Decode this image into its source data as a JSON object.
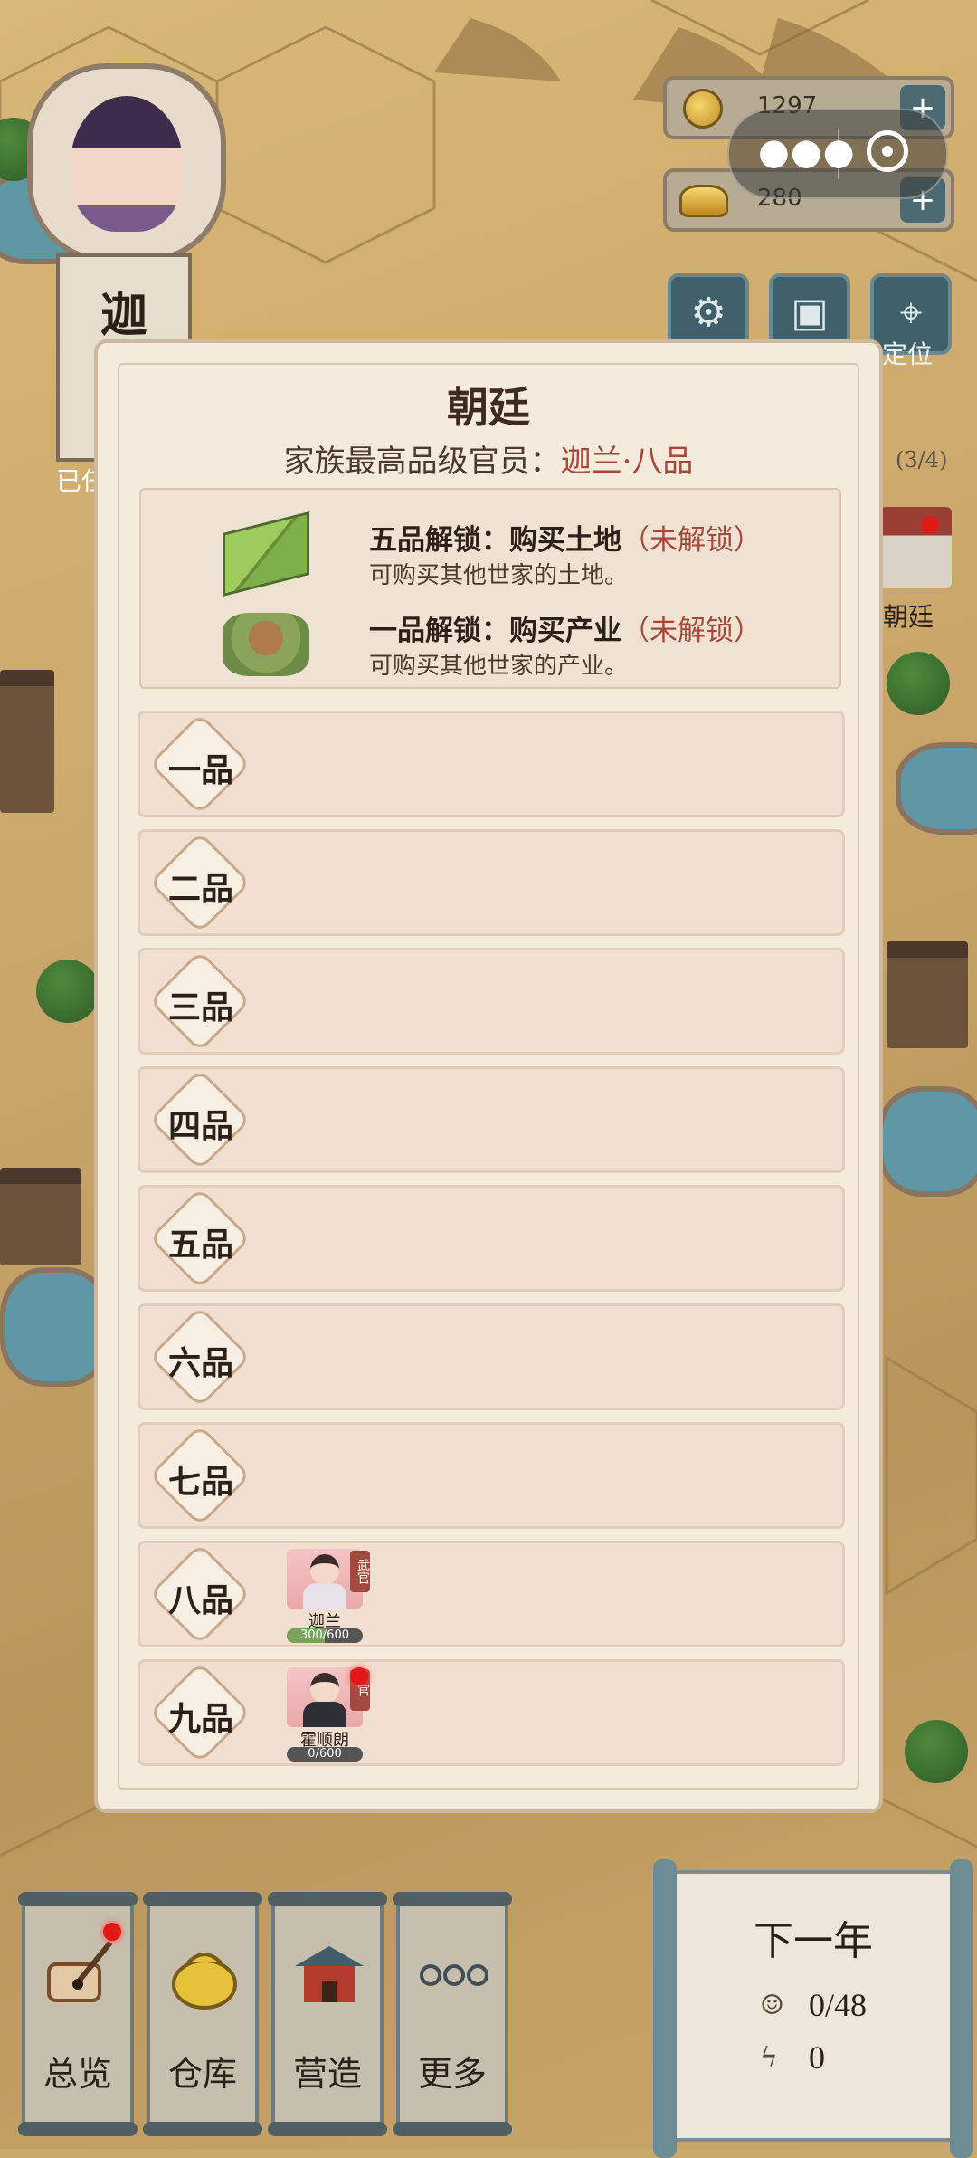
{
  "character": {
    "name_char": "迦",
    "status_partial": "已任"
  },
  "resources": {
    "copper": "1297",
    "gold": "280",
    "plus": "+"
  },
  "tools": {
    "settings_icon": "gear-icon",
    "save_icon": "save-icon",
    "locate_icon": "location-pin-icon",
    "locate_label": "定位"
  },
  "map_side": {
    "court_count": "(3/4)",
    "court_label": "朝廷"
  },
  "panel": {
    "title": "朝廷",
    "subtitle_prefix": "家族最高品级官员：",
    "subtitle_value": "迦兰·八品",
    "unlocks": [
      {
        "title": "五品解锁：购买土地",
        "status": "（未解锁）",
        "desc": "可购买其他世家的土地。",
        "icon": "farmland-icon"
      },
      {
        "title": "一品解锁：购买产业",
        "status": "（未解锁）",
        "desc": "可购买其他世家的产业。",
        "icon": "estate-icon"
      }
    ],
    "ranks": [
      {
        "label": "一品"
      },
      {
        "label": "二品"
      },
      {
        "label": "三品"
      },
      {
        "label": "四品"
      },
      {
        "label": "五品"
      },
      {
        "label": "六品"
      },
      {
        "label": "七品"
      },
      {
        "label": "八品",
        "official": {
          "name": "迦兰",
          "tag": "武官",
          "progress": "300/600",
          "ratio": 0.5
        }
      },
      {
        "label": "九品",
        "official": {
          "name": "霍顺朗",
          "tag": "官",
          "progress": "0/600",
          "ratio": 0.0,
          "notify": true
        }
      }
    ]
  },
  "nav": [
    {
      "label": "总览",
      "icon": "scroll-brush-icon",
      "notify": true
    },
    {
      "label": "仓库",
      "icon": "money-bag-icon"
    },
    {
      "label": "营造",
      "icon": "building-icon"
    },
    {
      "label": "更多",
      "icon": "more-dots-icon"
    }
  ],
  "next_year": {
    "title": "下一年",
    "workers": "0/48",
    "energy": "0"
  },
  "colors": {
    "accent_red": "#a5483a",
    "panel_bg": "#f4ebdd",
    "rank_row_bg": "#f1dfd2",
    "notify_red": "#e01818"
  }
}
